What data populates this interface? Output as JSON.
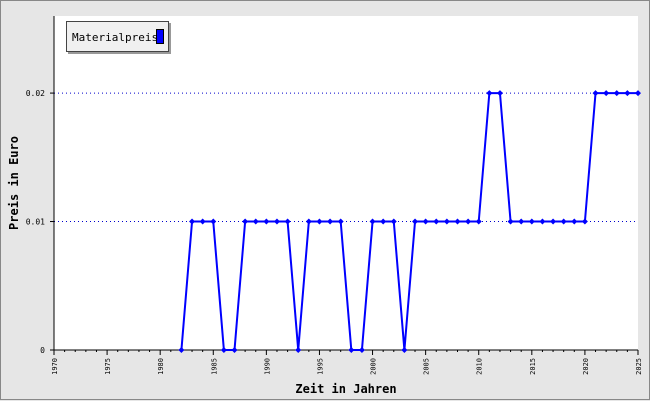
{
  "chart_data": {
    "type": "line",
    "xlabel": "Zeit in Jahren",
    "ylabel": "Preis in Euro",
    "xlim": [
      1970,
      2025
    ],
    "ylim": [
      0,
      0.026
    ],
    "x_ticks": [
      1970,
      1975,
      1980,
      1985,
      1990,
      1995,
      2000,
      2005,
      2010,
      2015,
      2020,
      2025
    ],
    "y_ticks": [
      0,
      0.01,
      0.02
    ],
    "y_tick_labels": [
      "0",
      "0.01",
      "0.02"
    ],
    "grid": "horizontal dotted at y ticks",
    "legend_position": "top-left",
    "series": [
      {
        "name": "Materialpreis",
        "color": "#0000ff",
        "x": [
          1982,
          1983,
          1984,
          1985,
          1986,
          1987,
          1988,
          1989,
          1990,
          1991,
          1992,
          1993,
          1994,
          1995,
          1996,
          1997,
          1998,
          1999,
          2000,
          2001,
          2002,
          2003,
          2004,
          2005,
          2006,
          2007,
          2008,
          2009,
          2010,
          2011,
          2012,
          2013,
          2014,
          2015,
          2016,
          2017,
          2018,
          2019,
          2020,
          2021,
          2022,
          2023,
          2024,
          2025
        ],
        "values": [
          0,
          0.01,
          0.01,
          0.01,
          0,
          0,
          0.01,
          0.01,
          0.01,
          0.01,
          0.01,
          0,
          0.01,
          0.01,
          0.01,
          0.01,
          0,
          0,
          0.01,
          0.01,
          0.01,
          0,
          0.01,
          0.01,
          0.01,
          0.01,
          0.01,
          0.01,
          0.01,
          0.02,
          0.02,
          0.01,
          0.01,
          0.01,
          0.01,
          0.01,
          0.01,
          0.01,
          0.01,
          0.02,
          0.02,
          0.02,
          0.02,
          0.02
        ]
      }
    ]
  }
}
